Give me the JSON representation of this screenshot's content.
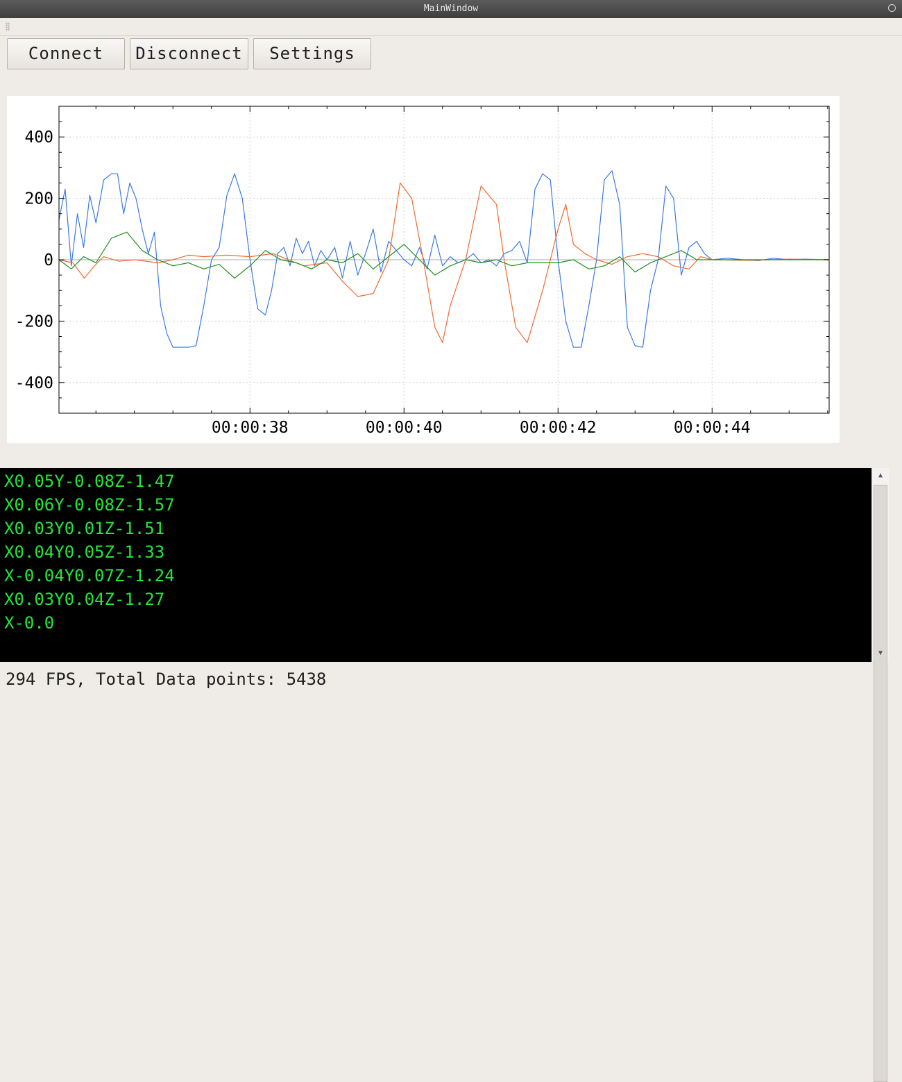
{
  "window": {
    "title": "MainWindow"
  },
  "toolbar": {
    "connect_label": "Connect",
    "disconnect_label": "Disconnect",
    "settings_label": "Settings"
  },
  "icons": {
    "close": "circle-close-icon",
    "toolbar_grip": "grip-icon"
  },
  "colors": {
    "series_blue": "#3a78e8",
    "series_orange": "#ef6a2f",
    "series_green": "#1f8f1f",
    "console_text": "#23e63a",
    "console_bg": "#000000"
  },
  "chart_data": {
    "type": "line",
    "title": "",
    "xlabel": "",
    "ylabel": "",
    "ylim": [
      -500,
      500
    ],
    "xlim": [
      35.52,
      45.52
    ],
    "xtick_labels": [
      "00:00:38",
      "00:00:40",
      "00:00:42",
      "00:00:44"
    ],
    "xticks": [
      38,
      40,
      42,
      44
    ],
    "ytick_labels": [
      "400",
      "200",
      "0",
      "-200",
      "-400"
    ],
    "yticks": [
      400,
      200,
      0,
      -200,
      -400
    ],
    "grid": true,
    "series": [
      {
        "color": "#3a78e8",
        "x": [
          35.52,
          35.6,
          35.68,
          35.76,
          35.84,
          35.92,
          36.0,
          36.1,
          36.2,
          36.28,
          36.36,
          36.44,
          36.52,
          36.6,
          36.68,
          36.76,
          36.84,
          36.92,
          37.0,
          37.1,
          37.2,
          37.3,
          37.4,
          37.5,
          37.6,
          37.7,
          37.8,
          37.9,
          38.0,
          38.1,
          38.2,
          38.28,
          38.36,
          38.44,
          38.52,
          38.6,
          38.68,
          38.76,
          38.84,
          38.92,
          39.0,
          39.1,
          39.2,
          39.3,
          39.4,
          39.5,
          39.6,
          39.7,
          39.8,
          39.9,
          40.0,
          40.1,
          40.2,
          40.3,
          40.4,
          40.5,
          40.6,
          40.7,
          40.8,
          40.9,
          41.0,
          41.1,
          41.2,
          41.3,
          41.4,
          41.5,
          41.6,
          41.7,
          41.8,
          41.9,
          42.0,
          42.1,
          42.2,
          42.3,
          42.4,
          42.5,
          42.6,
          42.7,
          42.8,
          42.9,
          43.0,
          43.1,
          43.2,
          43.3,
          43.4,
          43.5,
          43.6,
          43.7,
          43.8,
          43.9,
          44.0,
          44.2,
          44.4,
          44.6,
          44.8,
          45.0,
          45.2,
          45.52
        ],
        "values": [
          130,
          230,
          -20,
          150,
          40,
          210,
          120,
          260,
          280,
          280,
          150,
          250,
          200,
          100,
          20,
          90,
          -150,
          -240,
          -285,
          -285,
          -285,
          -280,
          -150,
          0,
          40,
          210,
          280,
          200,
          0,
          -160,
          -180,
          -100,
          20,
          40,
          -20,
          70,
          20,
          60,
          -20,
          30,
          0,
          40,
          -60,
          60,
          -50,
          20,
          100,
          -40,
          60,
          30,
          0,
          -20,
          40,
          -30,
          80,
          -20,
          10,
          -10,
          0,
          20,
          -10,
          0,
          -20,
          20,
          30,
          60,
          -10,
          230,
          280,
          260,
          0,
          -200,
          -285,
          -285,
          -150,
          0,
          260,
          290,
          180,
          -220,
          -280,
          -285,
          -100,
          0,
          240,
          200,
          -50,
          40,
          60,
          20,
          0,
          5,
          0,
          -3,
          5,
          0,
          2,
          0
        ]
      },
      {
        "color": "#ef6a2f",
        "x": [
          35.52,
          35.7,
          35.85,
          35.98,
          36.1,
          36.3,
          36.5,
          36.8,
          37.0,
          37.2,
          37.4,
          37.7,
          38.0,
          38.3,
          38.5,
          38.7,
          39.0,
          39.2,
          39.4,
          39.6,
          39.8,
          39.95,
          40.1,
          40.25,
          40.4,
          40.5,
          40.6,
          40.8,
          41.0,
          41.2,
          41.3,
          41.45,
          41.6,
          41.8,
          42.0,
          42.1,
          42.2,
          42.35,
          42.5,
          42.7,
          42.9,
          43.1,
          43.3,
          43.5,
          43.7,
          43.85,
          44.0,
          44.5,
          45.0,
          45.52
        ],
        "values": [
          0,
          -10,
          -60,
          -20,
          10,
          -5,
          0,
          -10,
          0,
          15,
          10,
          15,
          10,
          20,
          0,
          -20,
          -10,
          -70,
          -120,
          -110,
          0,
          250,
          200,
          0,
          -220,
          -270,
          -150,
          0,
          240,
          180,
          0,
          -220,
          -270,
          -100,
          100,
          180,
          50,
          20,
          0,
          -15,
          10,
          20,
          10,
          -20,
          -30,
          10,
          0,
          -2,
          2,
          0
        ]
      },
      {
        "color": "#1f8f1f",
        "x": [
          35.52,
          35.68,
          35.84,
          36.0,
          36.2,
          36.4,
          36.6,
          36.8,
          37.0,
          37.2,
          37.4,
          37.6,
          37.8,
          38.0,
          38.2,
          38.4,
          38.6,
          38.8,
          39.0,
          39.2,
          39.4,
          39.6,
          39.8,
          40.0,
          40.2,
          40.4,
          40.6,
          40.8,
          41.0,
          41.2,
          41.4,
          41.6,
          41.8,
          42.0,
          42.2,
          42.4,
          42.6,
          42.8,
          43.0,
          43.2,
          43.4,
          43.6,
          43.8,
          44.0,
          44.5,
          45.0,
          45.52
        ],
        "values": [
          0,
          -30,
          10,
          -10,
          70,
          90,
          30,
          0,
          -20,
          -10,
          -30,
          -15,
          -60,
          -20,
          30,
          0,
          -10,
          -30,
          0,
          -10,
          20,
          -30,
          10,
          50,
          0,
          -50,
          -20,
          0,
          -10,
          0,
          -20,
          -10,
          -10,
          -10,
          0,
          -30,
          -20,
          10,
          -40,
          -10,
          10,
          30,
          0,
          0,
          0,
          0,
          0
        ]
      }
    ]
  },
  "console": {
    "lines": [
      "X0.05Y-0.08Z-1.47",
      "X0.06Y-0.08Z-1.57",
      "X0.03Y0.01Z-1.51",
      "X0.04Y0.05Z-1.33",
      "X-0.04Y0.07Z-1.24",
      "X0.03Y0.04Z-1.27",
      "X-0.0"
    ]
  },
  "scrollbar": {
    "up_icon": "arrow-up-icon",
    "down_icon": "arrow-down-icon"
  },
  "status": {
    "text": "294 FPS, Total Data points: 5438"
  }
}
